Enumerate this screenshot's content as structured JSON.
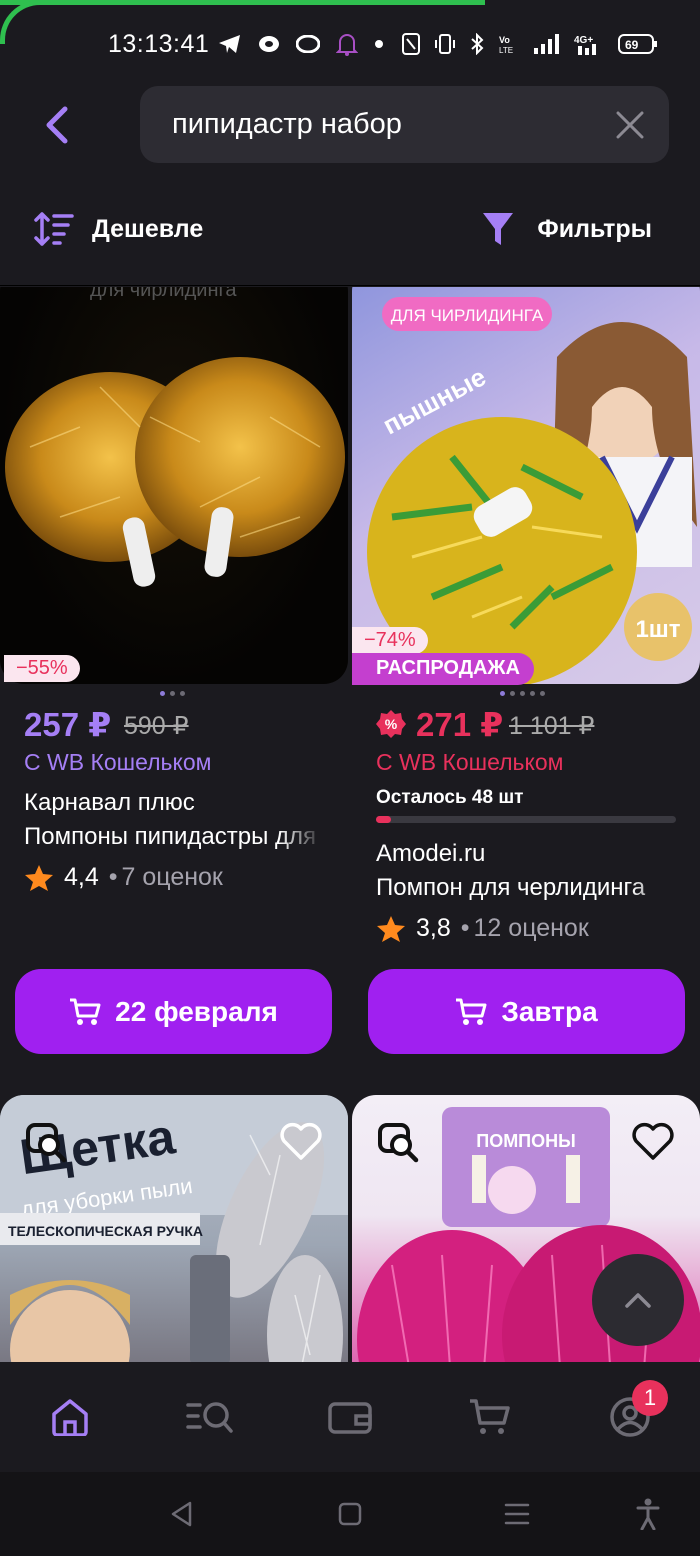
{
  "status_bar": {
    "time": "13:13:41",
    "battery": "69",
    "network": "4G+"
  },
  "search": {
    "query": "пипидастр набор"
  },
  "toolbar": {
    "sort_label": "Дешевле",
    "filter_label": "Фильтры"
  },
  "products": [
    {
      "discount": "−55%",
      "price": "257 ₽",
      "old_price": "590 ₽",
      "wallet": "С WB Кошельком",
      "brand": "Карнавал плюс",
      "name": "Помпоны пипидастры для",
      "rating": "4,4",
      "reviews": "7 оценок",
      "delivery": "22 февраля",
      "image_caption": "для чирлидинга"
    },
    {
      "discount": "−74%",
      "sale_label": "РАСПРОДАЖА",
      "price": "271 ₽",
      "old_price": "1 101 ₽",
      "wallet": "С WB Кошельком",
      "stock": "Осталось 48 шт",
      "stock_fraction": 0.05,
      "brand": "Amodei.ru",
      "name": "Помпон для черлидинга",
      "rating": "3,8",
      "reviews": "12 оценок",
      "delivery": "Завтра",
      "image_caption": "ДЛЯ ЧИРЛИДИНГА",
      "image_word": "пышные",
      "image_badge": "1шт"
    },
    {
      "image_title": "Щетка",
      "image_subtitle": "для уборки пыли",
      "image_banner": "ТЕЛЕСКОПИЧЕСКАЯ РУЧКА"
    },
    {
      "image_title": "ПОМПОНЫ"
    }
  ],
  "bottom_nav": {
    "cart_badge": "1"
  },
  "colors": {
    "accent": "#a020f0",
    "accent_text": "#a57ff5",
    "sale_red": "#e8315c",
    "background": "#1b1a1f"
  }
}
